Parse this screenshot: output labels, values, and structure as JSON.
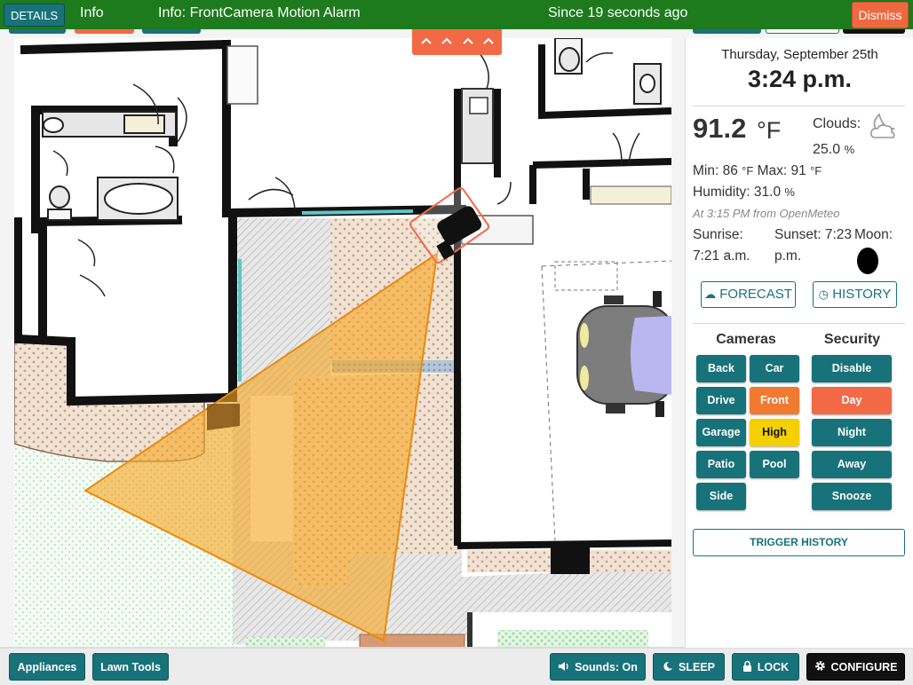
{
  "banner": {
    "details_label": "DETAILS",
    "level": "Info",
    "message": "Info: FrontCamera Motion Alarm",
    "since": "Since 19 seconds ago",
    "dismiss_label": "Dismiss",
    "background_color": "#1d7a1d"
  },
  "weather": {
    "date": "Thursday, September 25th",
    "time": "3:24 p.m.",
    "temperature": "91.2",
    "temperature_unit": "°F",
    "clouds_label": "Clouds:",
    "clouds_value": "25.0",
    "clouds_unit": "%",
    "min_label": "Min:",
    "min_value": "86",
    "max_label": "Max:",
    "max_value": "91",
    "unit_f": "°F",
    "humidity_label": "Humidity:",
    "humidity_value": "31.0",
    "humidity_unit": "%",
    "source": "At 3:15 PM from OpenMeteo",
    "sunrise_label": "Sunrise:",
    "sunrise_value": "7:21 a.m.",
    "sunset_label": "Sunset: 7:23",
    "sunset_value": "p.m.",
    "moon_label": "Moon:",
    "condition_icon": "cloud-moon-icon",
    "forecast_label": "FORECAST",
    "history_label": "HISTORY"
  },
  "cameras": {
    "header": "Cameras",
    "buttons": [
      {
        "label": "Back",
        "state": "normal"
      },
      {
        "label": "Car",
        "state": "normal"
      },
      {
        "label": "Drive",
        "state": "normal"
      },
      {
        "label": "Front",
        "state": "alarm"
      },
      {
        "label": "Garage",
        "state": "normal"
      },
      {
        "label": "High",
        "state": "warning"
      },
      {
        "label": "Patio",
        "state": "normal"
      },
      {
        "label": "Pool",
        "state": "normal"
      },
      {
        "label": "Side",
        "state": "normal"
      }
    ]
  },
  "security": {
    "header": "Security",
    "buttons": [
      {
        "label": "Disable",
        "state": "normal"
      },
      {
        "label": "Day",
        "state": "active"
      },
      {
        "label": "Night",
        "state": "normal"
      },
      {
        "label": "Away",
        "state": "normal"
      },
      {
        "label": "Snooze",
        "state": "normal"
      }
    ]
  },
  "trigger_history_label": "TRIGGER HISTORY",
  "bottom_bar": {
    "appliances_label": "Appliances",
    "lawn_tools_label": "Lawn Tools",
    "sounds_label": "Sounds: On",
    "sleep_label": "SLEEP",
    "lock_label": "LOCK",
    "configure_label": "CONFIGURE"
  },
  "colors": {
    "teal": "#18727a",
    "alarm_orange": "#f26a45",
    "warning_yellow": "#f5d000",
    "black": "#111111"
  }
}
